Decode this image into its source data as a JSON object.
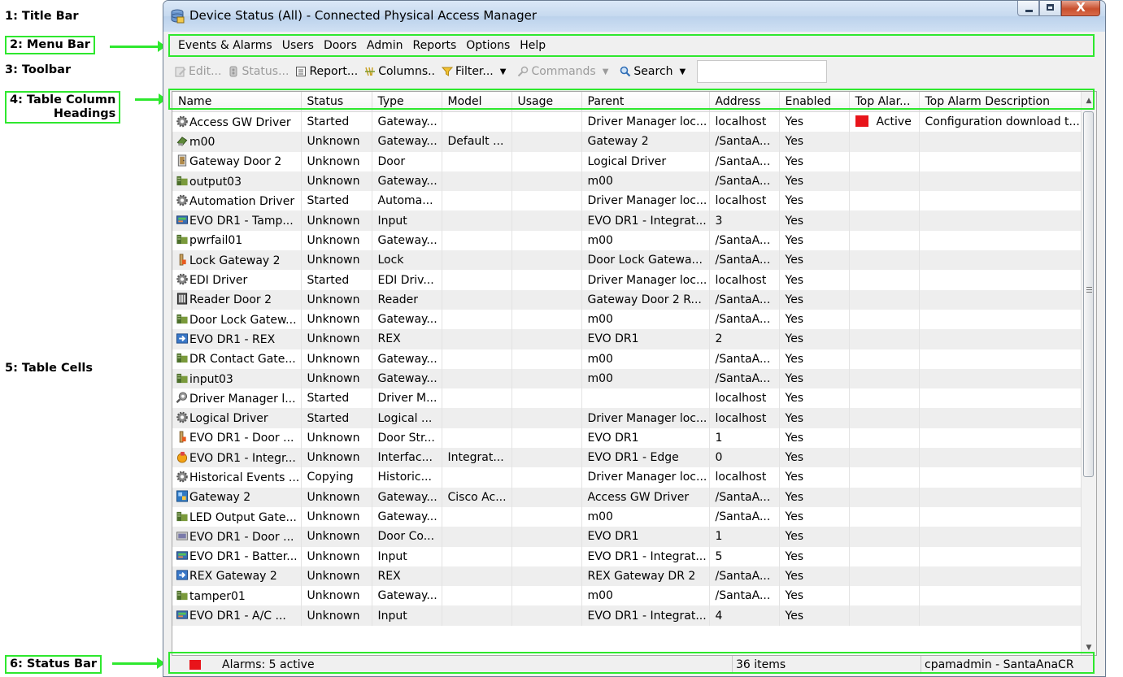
{
  "annotations": {
    "c1": "1: Title Bar",
    "c2": "2: Menu Bar",
    "c3": "3: Toolbar",
    "c4_line1": "4: Table Column",
    "c4_line2": "Headings",
    "c5": "5: Table Cells",
    "c6": "6: Status Bar"
  },
  "window": {
    "title": "Device Status (All) - Connected Physical Access Manager",
    "close_glyph": "X"
  },
  "menu": [
    "Events & Alarms",
    "Users",
    "Doors",
    "Admin",
    "Reports",
    "Options",
    "Help"
  ],
  "toolbar": {
    "edit": "Edit...",
    "status": "Status...",
    "report": "Report...",
    "columns": "Columns..",
    "filter": "Filter...",
    "commands": "Commands",
    "search": "Search",
    "caret": "▼",
    "search_value": ""
  },
  "table": {
    "columns": [
      "Name",
      "Status",
      "Type",
      "Model",
      "Usage",
      "Parent",
      "Address",
      "Enabled",
      "Top Alar...",
      "Top Alarm Description"
    ],
    "rows": [
      {
        "icon": "gear-icon",
        "name": "Access GW Driver",
        "status": "Started",
        "type": "Gateway...",
        "model": "",
        "usage": "",
        "parent": "Driver Manager loc...",
        "address": "localhost",
        "enabled": "Yes",
        "top_alarm": "Active",
        "top_alarm_desc": "Configuration download t..."
      },
      {
        "icon": "edge-device-icon",
        "name": "m00",
        "status": "Unknown",
        "type": "Gateway...",
        "model": "Default ...",
        "usage": "",
        "parent": "Gateway  2",
        "address": "/SantaA...",
        "enabled": "Yes",
        "top_alarm": "",
        "top_alarm_desc": ""
      },
      {
        "icon": "door-icon",
        "name": "Gateway Door 2",
        "status": "Unknown",
        "type": "Door",
        "model": "",
        "usage": "",
        "parent": "Logical Driver",
        "address": "/SantaA...",
        "enabled": "Yes",
        "top_alarm": "",
        "top_alarm_desc": ""
      },
      {
        "icon": "gateway-io-icon",
        "name": "output03",
        "status": "Unknown",
        "type": "Gateway...",
        "model": "",
        "usage": "",
        "parent": "m00",
        "address": "/SantaA...",
        "enabled": "Yes",
        "top_alarm": "",
        "top_alarm_desc": ""
      },
      {
        "icon": "gear-icon",
        "name": "Automation Driver",
        "status": "Started",
        "type": "Automa...",
        "model": "",
        "usage": "",
        "parent": "Driver Manager loc...",
        "address": "localhost",
        "enabled": "Yes",
        "top_alarm": "",
        "top_alarm_desc": ""
      },
      {
        "icon": "input-icon",
        "name": "EVO DR1 - Tamp...",
        "status": "Unknown",
        "type": "Input",
        "model": "",
        "usage": "",
        "parent": "EVO DR1 - Integrat...",
        "address": "3",
        "enabled": "Yes",
        "top_alarm": "",
        "top_alarm_desc": ""
      },
      {
        "icon": "gateway-io-icon",
        "name": "pwrfail01",
        "status": "Unknown",
        "type": "Gateway...",
        "model": "",
        "usage": "",
        "parent": "m00",
        "address": "/SantaA...",
        "enabled": "Yes",
        "top_alarm": "",
        "top_alarm_desc": ""
      },
      {
        "icon": "lock-icon",
        "name": "Lock Gateway 2",
        "status": "Unknown",
        "type": "Lock",
        "model": "",
        "usage": "",
        "parent": "Door Lock Gatewa...",
        "address": "/SantaA...",
        "enabled": "Yes",
        "top_alarm": "",
        "top_alarm_desc": ""
      },
      {
        "icon": "gear-icon",
        "name": "EDI Driver",
        "status": "Started",
        "type": "EDI Driv...",
        "model": "",
        "usage": "",
        "parent": "Driver Manager loc...",
        "address": "localhost",
        "enabled": "Yes",
        "top_alarm": "",
        "top_alarm_desc": ""
      },
      {
        "icon": "reader-icon",
        "name": "Reader Door 2",
        "status": "Unknown",
        "type": "Reader",
        "model": "",
        "usage": "",
        "parent": "Gateway Door 2 R...",
        "address": "/SantaA...",
        "enabled": "Yes",
        "top_alarm": "",
        "top_alarm_desc": ""
      },
      {
        "icon": "gateway-io-icon",
        "name": "Door Lock Gatew...",
        "status": "Unknown",
        "type": "Gateway...",
        "model": "",
        "usage": "",
        "parent": "m00",
        "address": "/SantaA...",
        "enabled": "Yes",
        "top_alarm": "",
        "top_alarm_desc": ""
      },
      {
        "icon": "rex-icon",
        "name": "EVO DR1 - REX",
        "status": "Unknown",
        "type": "REX",
        "model": "",
        "usage": "",
        "parent": "EVO DR1",
        "address": "2",
        "enabled": "Yes",
        "top_alarm": "",
        "top_alarm_desc": ""
      },
      {
        "icon": "gateway-io-icon",
        "name": "DR Contact Gate...",
        "status": "Unknown",
        "type": "Gateway...",
        "model": "",
        "usage": "",
        "parent": "m00",
        "address": "/SantaA...",
        "enabled": "Yes",
        "top_alarm": "",
        "top_alarm_desc": ""
      },
      {
        "icon": "gateway-io-icon",
        "name": "input03",
        "status": "Unknown",
        "type": "Gateway...",
        "model": "",
        "usage": "",
        "parent": "m00",
        "address": "/SantaA...",
        "enabled": "Yes",
        "top_alarm": "",
        "top_alarm_desc": ""
      },
      {
        "icon": "driver-manager-icon",
        "name": "Driver Manager l...",
        "status": "Started",
        "type": "Driver M...",
        "model": "",
        "usage": "",
        "parent": "",
        "address": "localhost",
        "enabled": "Yes",
        "top_alarm": "",
        "top_alarm_desc": ""
      },
      {
        "icon": "gear-icon",
        "name": "Logical Driver",
        "status": "Started",
        "type": "Logical ...",
        "model": "",
        "usage": "",
        "parent": "Driver Manager loc...",
        "address": "localhost",
        "enabled": "Yes",
        "top_alarm": "",
        "top_alarm_desc": ""
      },
      {
        "icon": "lock-icon",
        "name": "EVO DR1 - Door ...",
        "status": "Unknown",
        "type": "Door Str...",
        "model": "",
        "usage": "",
        "parent": "EVO DR1",
        "address": "1",
        "enabled": "Yes",
        "top_alarm": "",
        "top_alarm_desc": ""
      },
      {
        "icon": "interface-icon",
        "name": "EVO DR1 - Integr...",
        "status": "Unknown",
        "type": "Interfac...",
        "model": "Integrat...",
        "usage": "",
        "parent": "EVO DR1 - Edge",
        "address": "0",
        "enabled": "Yes",
        "top_alarm": "",
        "top_alarm_desc": ""
      },
      {
        "icon": "gear-icon",
        "name": "Historical Events ...",
        "status": "Copying",
        "type": "Historic...",
        "model": "",
        "usage": "",
        "parent": "Driver Manager loc...",
        "address": "localhost",
        "enabled": "Yes",
        "top_alarm": "",
        "top_alarm_desc": ""
      },
      {
        "icon": "gateway-device-icon",
        "name": "Gateway  2",
        "status": "Unknown",
        "type": "Gateway...",
        "model": "Cisco Ac...",
        "usage": "",
        "parent": "Access GW Driver",
        "address": "/SantaA...",
        "enabled": "Yes",
        "top_alarm": "",
        "top_alarm_desc": ""
      },
      {
        "icon": "gateway-io-icon",
        "name": "LED Output Gate...",
        "status": "Unknown",
        "type": "Gateway...",
        "model": "",
        "usage": "",
        "parent": "m00",
        "address": "/SantaA...",
        "enabled": "Yes",
        "top_alarm": "",
        "top_alarm_desc": ""
      },
      {
        "icon": "door-contact-icon",
        "name": "EVO DR1 - Door ...",
        "status": "Unknown",
        "type": "Door Co...",
        "model": "",
        "usage": "",
        "parent": "EVO DR1",
        "address": "1",
        "enabled": "Yes",
        "top_alarm": "",
        "top_alarm_desc": ""
      },
      {
        "icon": "input-icon",
        "name": "EVO DR1 - Batter...",
        "status": "Unknown",
        "type": "Input",
        "model": "",
        "usage": "",
        "parent": "EVO DR1 - Integrat...",
        "address": "5",
        "enabled": "Yes",
        "top_alarm": "",
        "top_alarm_desc": ""
      },
      {
        "icon": "rex-icon",
        "name": "REX Gateway 2",
        "status": "Unknown",
        "type": "REX",
        "model": "",
        "usage": "",
        "parent": "REX Gateway DR 2",
        "address": "/SantaA...",
        "enabled": "Yes",
        "top_alarm": "",
        "top_alarm_desc": ""
      },
      {
        "icon": "gateway-io-icon",
        "name": "tamper01",
        "status": "Unknown",
        "type": "Gateway...",
        "model": "",
        "usage": "",
        "parent": "m00",
        "address": "/SantaA...",
        "enabled": "Yes",
        "top_alarm": "",
        "top_alarm_desc": ""
      },
      {
        "icon": "input-icon",
        "name": "EVO DR1 - A/C ...",
        "status": "Unknown",
        "type": "Input",
        "model": "",
        "usage": "",
        "parent": "EVO DR1 - Integrat...",
        "address": "4",
        "enabled": "Yes",
        "top_alarm": "",
        "top_alarm_desc": ""
      }
    ]
  },
  "statusbar": {
    "alarms": "Alarms: 5 active",
    "items": "36 items",
    "user": "cpamadmin - SantaAnaCR"
  },
  "colors": {
    "alarm_red": "#e8141a",
    "callout_green": "#2ee82e",
    "row_alt": "#eeeeee"
  }
}
